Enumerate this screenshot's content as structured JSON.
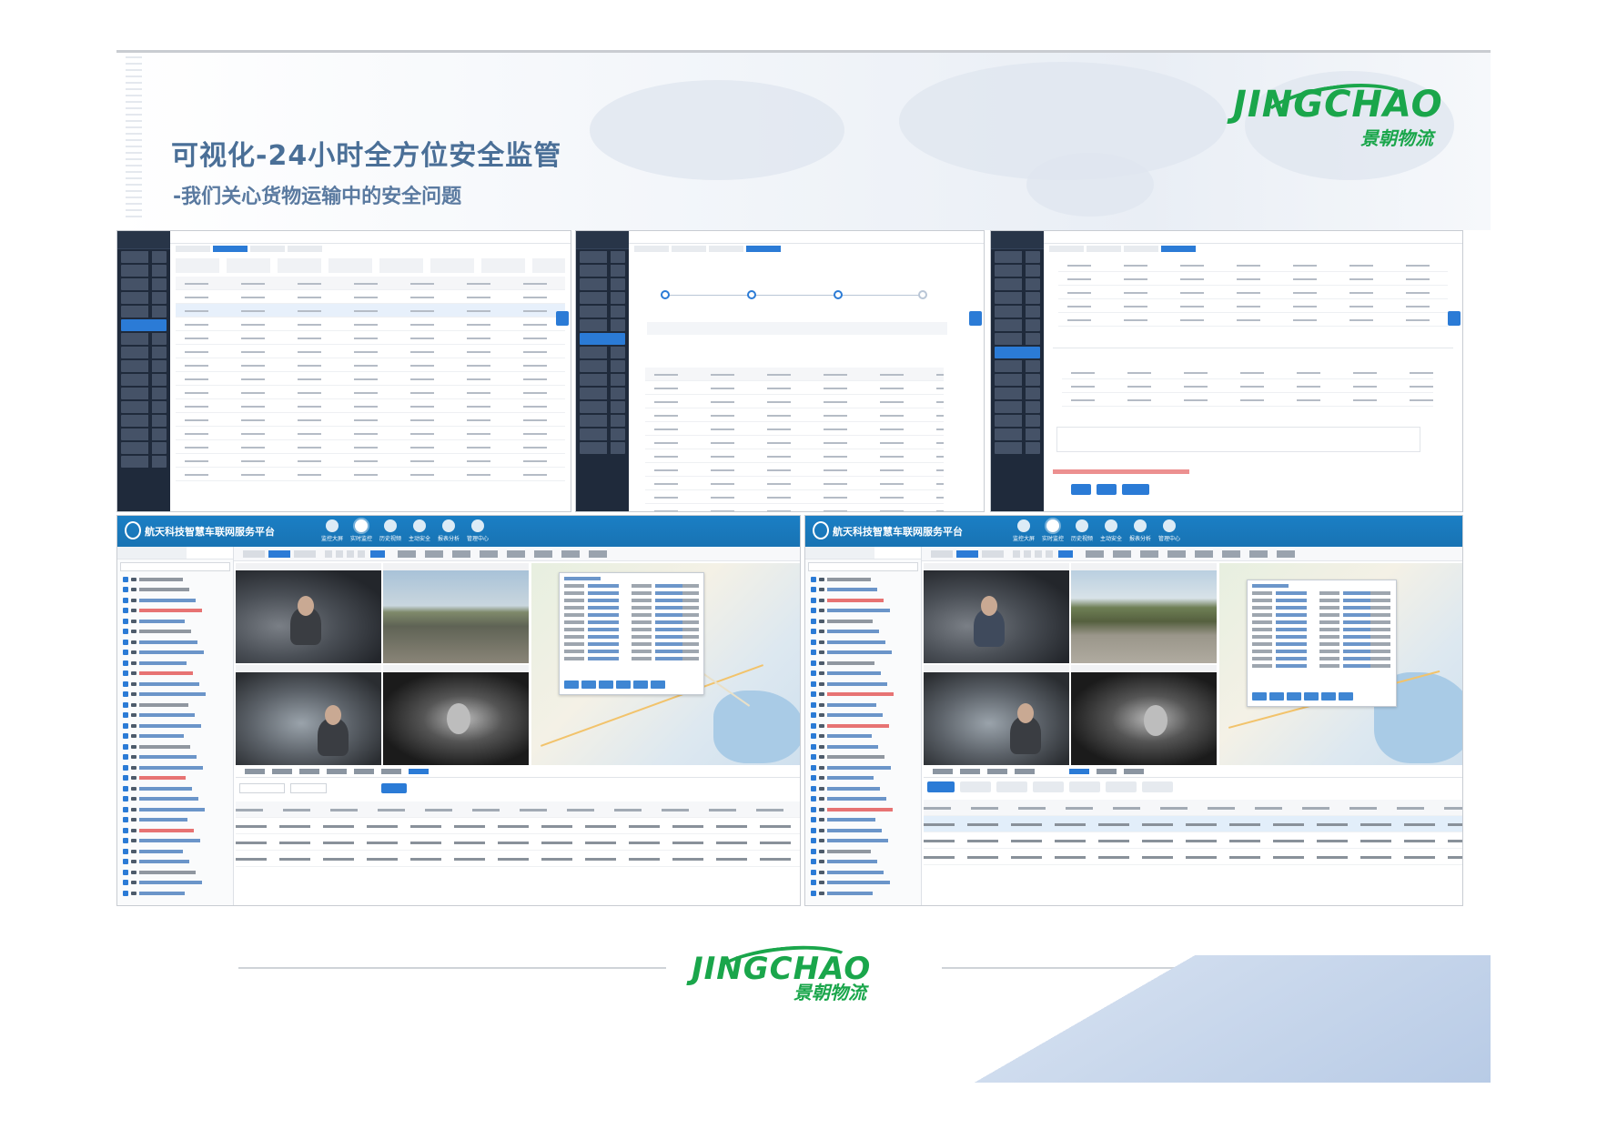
{
  "slide": {
    "title": "可视化-24小时全方位安全监管",
    "subtitle": "-我们关心货物运输中的安全问题",
    "logo_en": "JINGCHAO",
    "logo_cn": "景朝物流"
  },
  "monitor_left": {
    "platform_title": "航天科技智慧车联网服务平台",
    "nav": [
      "监控大屏",
      "实时监控",
      "历史视频",
      "主动安全",
      "报表分析",
      "管理中心"
    ]
  },
  "monitor_right": {
    "platform_title": "航天科技智慧车联网服务平台",
    "nav": [
      "监控大屏",
      "实时监控",
      "历史视频",
      "主动安全",
      "报表分析",
      "管理中心"
    ]
  },
  "colors": {
    "title": "#4a6f97",
    "logo_green": "#1aa64b",
    "platform_blue": "#1b7fc5",
    "accent": "#2b7bd6"
  },
  "icons": [
    "world-map",
    "platform-logo-icon",
    "nav-circle-icon",
    "car-icon",
    "checkbox-icon"
  ]
}
